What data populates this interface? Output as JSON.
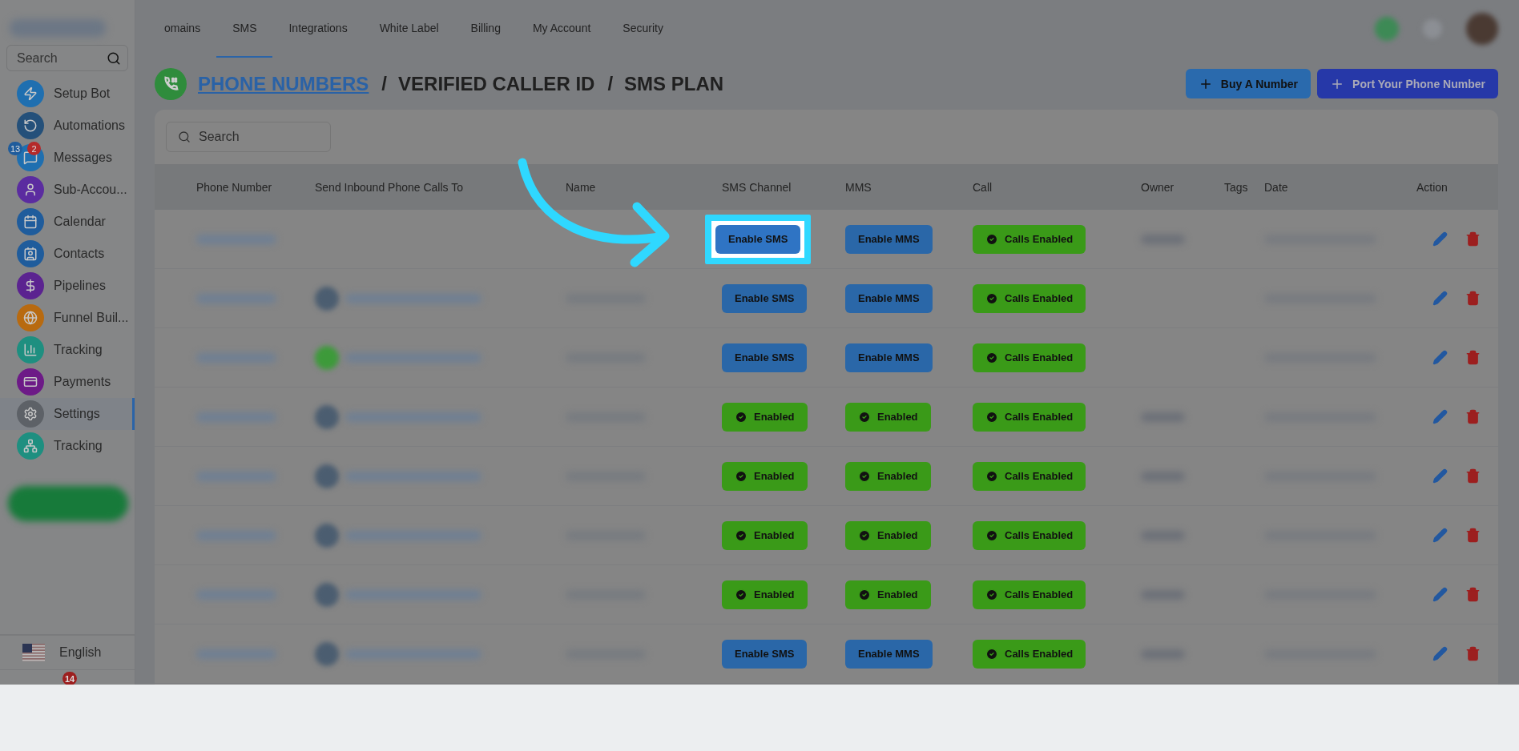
{
  "top_nav": [
    {
      "label": "omains",
      "selected": false
    },
    {
      "label": "SMS",
      "selected": true
    },
    {
      "label": "Integrations",
      "selected": false
    },
    {
      "label": "White Label",
      "selected": false
    },
    {
      "label": "Billing",
      "selected": false
    },
    {
      "label": "My Account",
      "selected": false
    },
    {
      "label": "Security",
      "selected": false
    }
  ],
  "sidebar": {
    "search": {
      "placeholder": "Search"
    },
    "items": [
      {
        "label": "Setup Bot",
        "color": "#1f6fb0",
        "selected": false
      },
      {
        "label": "Automations",
        "color": "#24507a",
        "selected": false
      },
      {
        "label": "Messages",
        "color": "#1f6fb0",
        "selected": false,
        "badges": [
          {
            "text": "13",
            "color": "#1f5c9c"
          },
          {
            "text": "2",
            "color": "#b52a2a"
          }
        ]
      },
      {
        "label": "Sub-Accou...",
        "color": "#5b2ca0",
        "selected": false
      },
      {
        "label": "Calendar",
        "color": "#1f5c9c",
        "selected": false
      },
      {
        "label": "Contacts",
        "color": "#1f5c9c",
        "selected": false
      },
      {
        "label": "Pipelines",
        "color": "#5b2390",
        "selected": false
      },
      {
        "label": "Funnel Buil...",
        "color": "#b86a10",
        "selected": false
      },
      {
        "label": "Tracking",
        "color": "#1e8f80",
        "selected": false
      },
      {
        "label": "Payments",
        "color": "#6d1a87",
        "selected": false
      },
      {
        "label": "Settings",
        "color": "#5d6167",
        "selected": true
      },
      {
        "label": "Tracking",
        "color": "#1e8f80",
        "selected": false
      }
    ],
    "language": "English",
    "bottom_badge": "14"
  },
  "header": {
    "breadcrumb": [
      {
        "label": "PHONE NUMBERS",
        "kind": "link"
      },
      {
        "label": "/",
        "kind": "separator"
      },
      {
        "label": "VERIFIED CALLER ID",
        "kind": "text"
      },
      {
        "label": "/",
        "kind": "separator"
      },
      {
        "label": "SMS PLAN",
        "kind": "text"
      }
    ],
    "buttons": [
      {
        "label": "Buy A Number",
        "color": "#2a6aad"
      },
      {
        "label": "Port Your Phone Number",
        "color": "#2638a8"
      }
    ]
  },
  "table": {
    "search": {
      "placeholder": "Search"
    },
    "columns": [
      "Phone Number",
      "Send Inbound Phone Calls To",
      "Name",
      "SMS Channel",
      "MMS",
      "Call",
      "Owner",
      "Tags",
      "Date",
      "Action"
    ],
    "rows": [
      {
        "highlighted": true,
        "owner_shown": true,
        "sms": {
          "kind": "button",
          "label": "Enable SMS"
        },
        "mms": {
          "kind": "button",
          "label": "Enable MMS"
        },
        "call": {
          "kind": "enabled",
          "label": "Calls Enabled"
        }
      },
      {
        "highlighted": false,
        "forward": {
          "color": "#4b5d70"
        },
        "owner_shown": false,
        "sms": {
          "kind": "button",
          "label": "Enable SMS"
        },
        "mms": {
          "kind": "button",
          "label": "Enable MMS"
        },
        "call": {
          "kind": "enabled",
          "label": "Calls Enabled"
        }
      },
      {
        "highlighted": false,
        "forward": {
          "color": "#3d9a3a"
        },
        "owner_shown": false,
        "sms": {
          "kind": "button",
          "label": "Enable SMS"
        },
        "mms": {
          "kind": "button",
          "label": "Enable MMS"
        },
        "call": {
          "kind": "enabled",
          "label": "Calls Enabled"
        }
      },
      {
        "highlighted": false,
        "forward": {
          "color": "#4b5d70"
        },
        "owner_shown": true,
        "sms": {
          "kind": "enabled",
          "label": "Enabled"
        },
        "mms": {
          "kind": "enabled",
          "label": "Enabled"
        },
        "call": {
          "kind": "enabled",
          "label": "Calls Enabled"
        }
      },
      {
        "highlighted": false,
        "forward": {
          "color": "#4b5d70"
        },
        "owner_shown": true,
        "sms": {
          "kind": "enabled",
          "label": "Enabled"
        },
        "mms": {
          "kind": "enabled",
          "label": "Enabled"
        },
        "call": {
          "kind": "enabled",
          "label": "Calls Enabled"
        }
      },
      {
        "highlighted": false,
        "forward": {
          "color": "#4b5d70"
        },
        "owner_shown": true,
        "sms": {
          "kind": "enabled",
          "label": "Enabled"
        },
        "mms": {
          "kind": "enabled",
          "label": "Enabled"
        },
        "call": {
          "kind": "enabled",
          "label": "Calls Enabled"
        }
      },
      {
        "highlighted": false,
        "forward": {
          "color": "#4b5d70"
        },
        "owner_shown": true,
        "sms": {
          "kind": "enabled",
          "label": "Enabled"
        },
        "mms": {
          "kind": "enabled",
          "label": "Enabled"
        },
        "call": {
          "kind": "enabled",
          "label": "Calls Enabled"
        }
      },
      {
        "highlighted": false,
        "forward": {
          "color": "#4b5d70"
        },
        "owner_shown": true,
        "sms": {
          "kind": "button",
          "label": "Enable SMS"
        },
        "mms": {
          "kind": "button",
          "label": "Enable MMS"
        },
        "call": {
          "kind": "enabled",
          "label": "Calls Enabled"
        }
      }
    ]
  }
}
